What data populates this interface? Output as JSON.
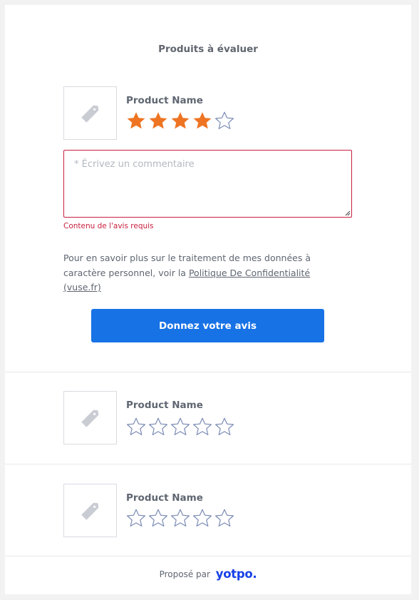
{
  "heading": "Produits à évaluer",
  "products": [
    {
      "name": "Product Name",
      "rating": 4,
      "max_rating": 5
    },
    {
      "name": "Product Name",
      "rating": 0,
      "max_rating": 5
    },
    {
      "name": "Product Name",
      "rating": 0,
      "max_rating": 5
    }
  ],
  "review": {
    "placeholder": "* Écrivez un commentaire",
    "value": "",
    "error": "Contenu de l'avis requis"
  },
  "privacy": {
    "text": "Pour en savoir plus sur le traitement de mes données à caractère personnel, voir la ",
    "link": "Politique De Confidentialité (vuse.fr)"
  },
  "submit_label": "Donnez votre avis",
  "footer": {
    "prefix": "Proposé par",
    "brand": "yotpo."
  },
  "icons": [
    "tag-icon",
    "star-icon"
  ],
  "colors": {
    "star_filled": "#ee7422",
    "star_empty": "#7b8bb5",
    "button": "#1772e6",
    "error": "#c8203f",
    "brand": "#1741e6"
  }
}
